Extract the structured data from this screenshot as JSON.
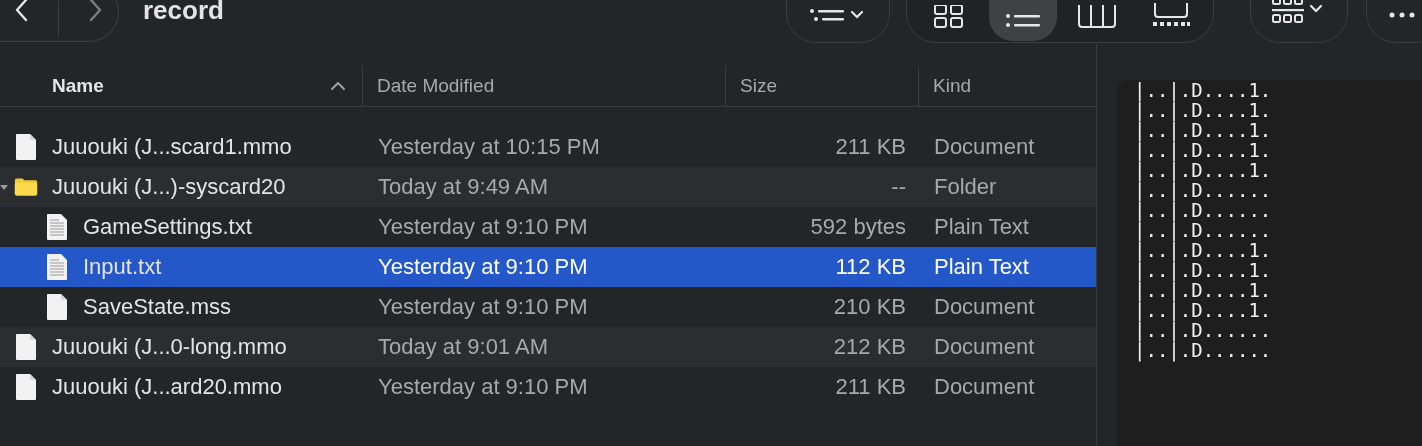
{
  "toolbar": {
    "title": "record",
    "view_modes": [
      {
        "kind": "icons",
        "selected": false
      },
      {
        "kind": "list",
        "selected": true
      },
      {
        "kind": "columns",
        "selected": false
      },
      {
        "kind": "gallery",
        "selected": false
      }
    ]
  },
  "table": {
    "columns": [
      {
        "label": "Name",
        "sorted": true
      },
      {
        "label": "Date Modified",
        "sorted": false
      },
      {
        "label": "Size",
        "sorted": false
      },
      {
        "label": "Kind",
        "sorted": false
      }
    ],
    "rows": [
      {
        "kind": "document",
        "name": "Juuouki (J...scard1.mmo",
        "date": "Yesterday at 10:15 PM",
        "size": "211 KB",
        "type": "Document",
        "selected": false
      },
      {
        "kind": "folder",
        "name": "Juuouki (J...)-syscard20",
        "date": "Today at 9:49 AM",
        "size": "--",
        "type": "Folder",
        "selected": false,
        "expanded": true,
        "children": [
          {
            "kind": "text",
            "name": "GameSettings.txt",
            "date": "Yesterday at 9:10 PM",
            "size": "592 bytes",
            "type": "Plain Text",
            "selected": false
          },
          {
            "kind": "text",
            "name": "Input.txt",
            "date": "Yesterday at 9:10 PM",
            "size": "112 KB",
            "type": "Plain Text",
            "selected": true
          },
          {
            "kind": "document",
            "name": "SaveState.mss",
            "date": "Yesterday at 9:10 PM",
            "size": "210 KB",
            "type": "Document",
            "selected": false
          }
        ]
      },
      {
        "kind": "document",
        "name": "Juuouki (J...0-long.mmo",
        "date": "Today at 9:01 AM",
        "size": "212 KB",
        "type": "Document",
        "selected": false
      },
      {
        "kind": "document",
        "name": "Juuouki (J...ard20.mmo",
        "date": "Yesterday at 9:10 PM",
        "size": "211 KB",
        "type": "Document",
        "selected": false
      }
    ]
  },
  "preview": {
    "lines": [
      "|..|.D....1.",
      "|..|.D....1.",
      "|..|.D....1.",
      "|..|.D....1.",
      "|..|.D....1.",
      "|..|.D......",
      "|..|.D......",
      "|..|.D......",
      "|..|.D....1.",
      "|..|.D....1.",
      "|..|.D....1.",
      "|..|.D....1.",
      "|..|.D......",
      "|..|.D......"
    ]
  }
}
